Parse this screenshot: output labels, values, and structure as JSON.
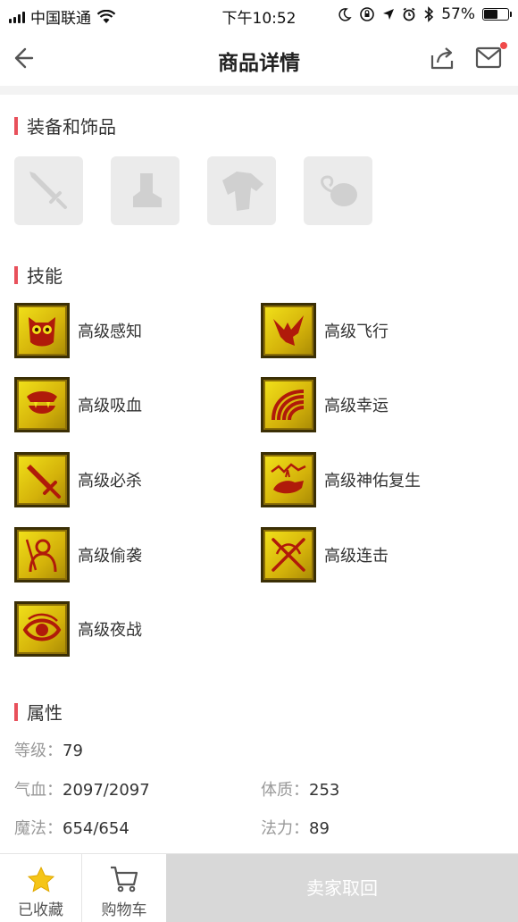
{
  "status": {
    "carrier": "中国联通",
    "time": "下午10:52",
    "battery": "57%",
    "battery_level": 0.57
  },
  "nav": {
    "title": "商品详情"
  },
  "equipment": {
    "title": "装备和饰品",
    "items": [
      {
        "icon": "sword-icon"
      },
      {
        "icon": "boot-icon"
      },
      {
        "icon": "armor-icon"
      },
      {
        "icon": "accessory-icon"
      }
    ]
  },
  "skills": {
    "title": "技能",
    "items": [
      {
        "label": "高级感知",
        "icon": "owl-icon"
      },
      {
        "label": "高级飞行",
        "icon": "eagle-icon"
      },
      {
        "label": "高级吸血",
        "icon": "fang-icon"
      },
      {
        "label": "高级幸运",
        "icon": "rainbow-icon"
      },
      {
        "label": "高级必杀",
        "icon": "sword-icon"
      },
      {
        "label": "高级神佑复生",
        "icon": "revive-icon"
      },
      {
        "label": "高级偷袭",
        "icon": "sneak-icon"
      },
      {
        "label": "高级连击",
        "icon": "combo-icon"
      },
      {
        "label": "高级夜战",
        "icon": "eye-icon"
      }
    ]
  },
  "attributes": {
    "title": "属性",
    "level_label": "等级：",
    "level": "79",
    "hp_label": "气血：",
    "hp": "2097/2097",
    "constitution_label": "体质：",
    "constitution": "253",
    "mp_label": "魔法：",
    "mp": "654/654",
    "magic_label": "法力：",
    "magic": "89"
  },
  "bottom": {
    "favorite_label": "已收藏",
    "cart_label": "购物车",
    "action_label": "卖家取回"
  }
}
